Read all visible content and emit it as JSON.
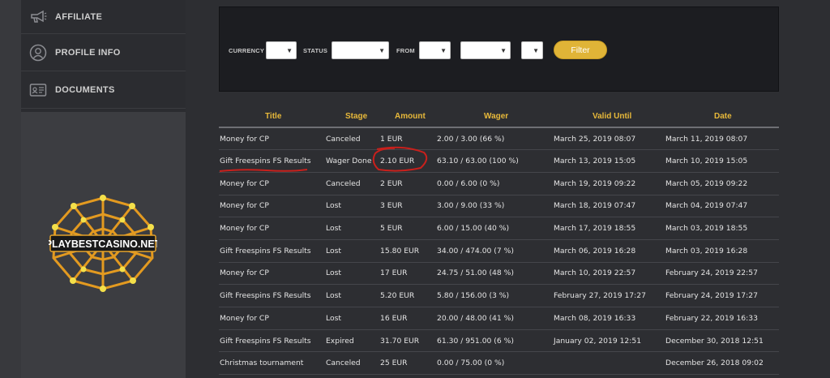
{
  "sidebar": {
    "items": [
      {
        "label": "AFFILIATE",
        "icon": "megaphone-icon"
      },
      {
        "label": "PROFILE INFO",
        "icon": "user-icon"
      },
      {
        "label": "DOCUMENTS",
        "icon": "id-card-icon"
      }
    ]
  },
  "logo": {
    "text": "PLAYBESTCASINO.NET"
  },
  "filter": {
    "currency_label": "CURRENCY",
    "status_label": "STATUS",
    "from_label": "FROM",
    "button_label": "Filter"
  },
  "table": {
    "headers": [
      "Title",
      "Stage",
      "Amount",
      "Wager",
      "Valid Until",
      "Date"
    ],
    "rows": [
      {
        "title": "Money for CP",
        "stage": "Canceled",
        "amount": "1 EUR",
        "wager": "2.00 / 3.00 (66 %)",
        "valid": "March 25, 2019 08:07",
        "date": "March 11, 2019 08:07"
      },
      {
        "title": "Gift Freespins FS Results",
        "stage": "Wager Done",
        "amount": "2.10 EUR",
        "wager": "63.10 / 63.00 (100 %)",
        "valid": "March 13, 2019 15:05",
        "date": "March 10, 2019 15:05"
      },
      {
        "title": "Money for CP",
        "stage": "Canceled",
        "amount": "2 EUR",
        "wager": "0.00 / 6.00 (0 %)",
        "valid": "March 19, 2019 09:22",
        "date": "March 05, 2019 09:22"
      },
      {
        "title": "Money for CP",
        "stage": "Lost",
        "amount": "3 EUR",
        "wager": "3.00 / 9.00 (33 %)",
        "valid": "March 18, 2019 07:47",
        "date": "March 04, 2019 07:47"
      },
      {
        "title": "Money for CP",
        "stage": "Lost",
        "amount": "5 EUR",
        "wager": "6.00 / 15.00 (40 %)",
        "valid": "March 17, 2019 18:55",
        "date": "March 03, 2019 18:55"
      },
      {
        "title": "Gift Freespins FS Results",
        "stage": "Lost",
        "amount": "15.80 EUR",
        "wager": "34.00 / 474.00 (7 %)",
        "valid": "March 06, 2019 16:28",
        "date": "March 03, 2019 16:28"
      },
      {
        "title": "Money for CP",
        "stage": "Lost",
        "amount": "17 EUR",
        "wager": "24.75 / 51.00 (48 %)",
        "valid": "March 10, 2019 22:57",
        "date": "February 24, 2019 22:57"
      },
      {
        "title": "Gift Freespins FS Results",
        "stage": "Lost",
        "amount": "5.20 EUR",
        "wager": "5.80 / 156.00 (3 %)",
        "valid": "February 27, 2019 17:27",
        "date": "February 24, 2019 17:27"
      },
      {
        "title": "Money for CP",
        "stage": "Lost",
        "amount": "16 EUR",
        "wager": "20.00 / 48.00 (41 %)",
        "valid": "March 08, 2019 16:33",
        "date": "February 22, 2019 16:33"
      },
      {
        "title": "Gift Freespins FS Results",
        "stage": "Expired",
        "amount": "31.70 EUR",
        "wager": "61.30 / 951.00 (6 %)",
        "valid": "January 02, 2019 12:51",
        "date": "December 30, 2018 12:51"
      },
      {
        "title": "Christmas tournament",
        "stage": "Canceled",
        "amount": "25 EUR",
        "wager": "0.00 / 75.00 (0 %)",
        "valid": "",
        "date": "December 26, 2018 09:02"
      }
    ]
  },
  "colors": {
    "accent": "#e0b437",
    "header_text": "#e8b93a",
    "annotation": "#c8201c"
  }
}
